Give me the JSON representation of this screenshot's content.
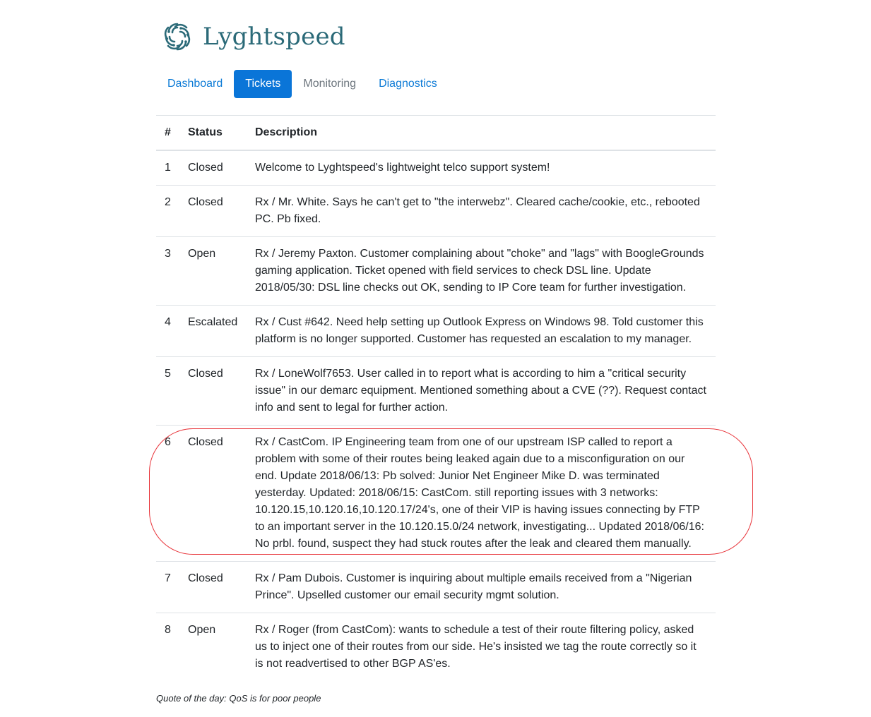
{
  "brand": {
    "name": "Lyghtspeed",
    "color": "#2b6a78",
    "icon": "lyghtspeed-logo-icon"
  },
  "nav": {
    "items": [
      {
        "label": "Dashboard",
        "state": "link"
      },
      {
        "label": "Tickets",
        "state": "active"
      },
      {
        "label": "Monitoring",
        "state": "disabled"
      },
      {
        "label": "Diagnostics",
        "state": "link"
      }
    ],
    "link_color": "#0d7bd6",
    "active_bg": "#0a75d8"
  },
  "tickets": {
    "headers": [
      "#",
      "Status",
      "Description"
    ],
    "rows": [
      {
        "num": "1",
        "status": "Closed",
        "description": "Welcome to Lyghtspeed's lightweight telco support system!"
      },
      {
        "num": "2",
        "status": "Closed",
        "description": "Rx / Mr. White. Says he can't get to \"the interwebz\". Cleared cache/cookie, etc., rebooted PC. Pb fixed."
      },
      {
        "num": "3",
        "status": "Open",
        "description": "Rx / Jeremy Paxton. Customer complaining about \"choke\" and \"lags\" with BoogleGrounds gaming application. Ticket opened with field services to check DSL line. Update 2018/05/30: DSL line checks out OK, sending to IP Core team for further investigation."
      },
      {
        "num": "4",
        "status": "Escalated",
        "description": "Rx / Cust #642. Need help setting up Outlook Express on Windows 98. Told customer this platform is no longer supported. Customer has requested an escalation to my manager."
      },
      {
        "num": "5",
        "status": "Closed",
        "description": "Rx / LoneWolf7653. User called in to report what is according to him a \"critical security issue\" in our demarc equipment. Mentioned something about a CVE (??). Request contact info and sent to legal for further action."
      },
      {
        "num": "6",
        "status": "Closed",
        "description": "Rx / CastCom. IP Engineering team from one of our upstream ISP called to report a problem with some of their routes being leaked again due to a misconfiguration on our end. Update 2018/06/13: Pb solved: Junior Net Engineer Mike D. was terminated yesterday. Updated: 2018/06/15: CastCom. still reporting issues with 3 networks: 10.120.15,10.120.16,10.120.17/24's, one of their VIP is having issues connecting by FTP to an important server in the 10.120.15.0/24 network, investigating... Updated 2018/06/16: No prbl. found, suspect they had stuck routes after the leak and cleared them manually."
      },
      {
        "num": "7",
        "status": "Closed",
        "description": "Rx / Pam Dubois. Customer is inquiring about multiple emails received from a \"Nigerian Prince\". Upselled customer our email security mgmt solution."
      },
      {
        "num": "8",
        "status": "Open",
        "description": "Rx / Roger (from CastCom): wants to schedule a test of their route filtering policy, asked us to inject one of their routes from our side. He's insisted we tag the route correctly so it is not readvertised to other BGP AS'es."
      }
    ]
  },
  "footer": {
    "quote": "Quote of the day: QoS is for poor people"
  },
  "annotation": {
    "highlighted_row": "6",
    "color": "#e8343a"
  }
}
